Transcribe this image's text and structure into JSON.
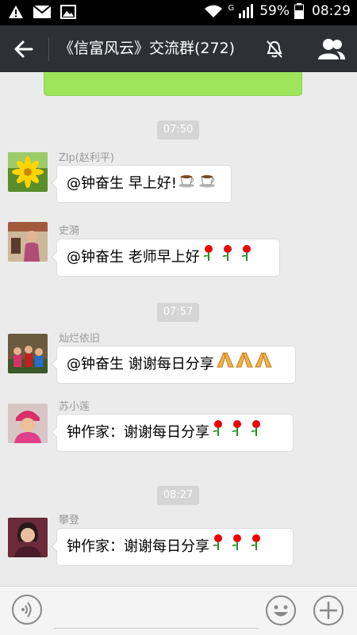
{
  "status_bar": {
    "battery": "59%",
    "time": "08:29",
    "network": "G"
  },
  "header": {
    "title": "《信富风云》交流群(272)"
  },
  "chat": {
    "timestamps": [
      "07:50",
      "07:57",
      "08:27"
    ],
    "messages": [
      {
        "sender": "Zlp(赵利平)",
        "text": "@钟奋生 早上好!",
        "emoji": "coffee-icon"
      },
      {
        "sender": "史漪",
        "text": "@钟奋生 老师早上好",
        "emoji": "rose-icon"
      },
      {
        "sender": "灿烂依旧",
        "text": "@钟奋生 谢谢每日分享",
        "emoji": "praying-hands-icon"
      },
      {
        "sender": "苏小莲",
        "text": "钟作家：谢谢每日分享",
        "emoji": "rose-icon"
      },
      {
        "sender": "攀登",
        "text": "钟作家：谢谢每日分享",
        "emoji": "rose-icon"
      }
    ]
  },
  "colors": {
    "navbar": "#2e3034",
    "background": "#ebebeb",
    "sent_bubble": "#9ee55c"
  }
}
